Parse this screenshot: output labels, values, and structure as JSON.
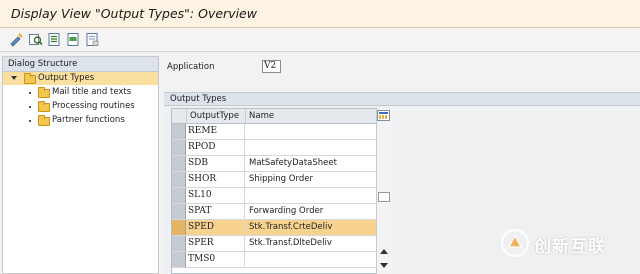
{
  "window": {
    "title": "Display View \"Output Types\": Overview"
  },
  "toolbar": {
    "buttons": [
      {
        "icon": "display-change-icon"
      },
      {
        "icon": "other-view-icon"
      },
      {
        "icon": "select-all-icon"
      },
      {
        "icon": "select-block-icon"
      },
      {
        "icon": "deselect-all-icon"
      }
    ]
  },
  "dialog_structure": {
    "header": "Dialog Structure",
    "items": [
      {
        "label": "Output Types",
        "level": 0,
        "selected": true,
        "expanded": true
      },
      {
        "label": "Mail title and texts",
        "level": 1
      },
      {
        "label": "Processing routines",
        "level": 1
      },
      {
        "label": "Partner functions",
        "level": 1
      }
    ]
  },
  "application": {
    "label": "Application",
    "value": "V2"
  },
  "output_types": {
    "header": "Output Types",
    "columns": [
      "OutputType",
      "Name"
    ],
    "rows": [
      {
        "code": "REME",
        "name": ""
      },
      {
        "code": "RPOD",
        "name": ""
      },
      {
        "code": "SDB",
        "name": "MatSafetyDataSheet"
      },
      {
        "code": "SHOR",
        "name": "Shipping Order"
      },
      {
        "code": "SL10",
        "name": ""
      },
      {
        "code": "SPAT",
        "name": "Forwarding Order"
      },
      {
        "code": "SPED",
        "name": "Stk.Transf.CrteDeliv",
        "selected": true
      },
      {
        "code": "SPER",
        "name": "Stk.Transf.DlteDeliv"
      },
      {
        "code": "TMS0",
        "name": ""
      }
    ]
  },
  "watermark": {
    "text": "创新互联"
  },
  "colors": {
    "title_bar": "#fdf3e2",
    "selection": "#f8d38f",
    "folder": "#f3c64e",
    "section_header": "#dde3ea"
  }
}
